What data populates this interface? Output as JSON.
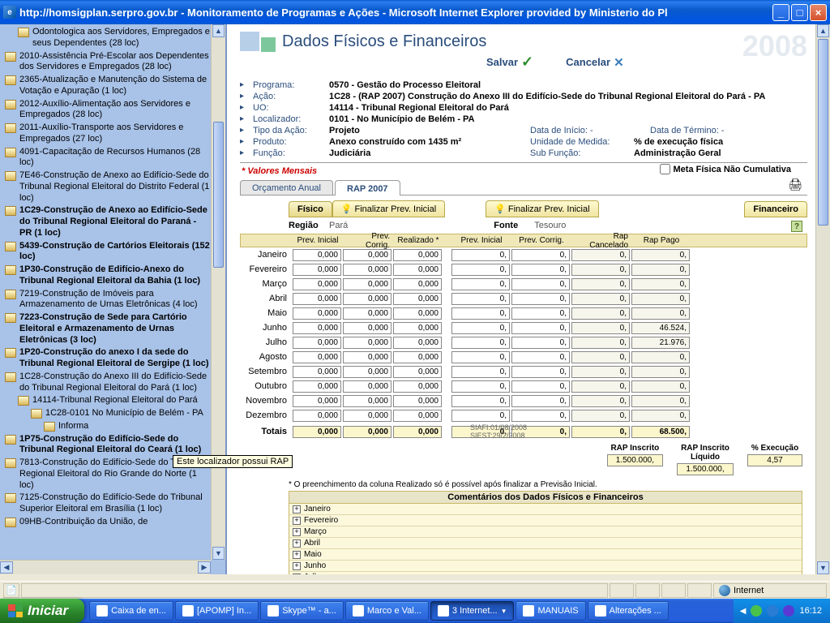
{
  "window": {
    "title": "http://homsigplan.serpro.gov.br - Monitoramento de Programas e Ações - Microsoft Internet Explorer provided by Ministerio do Pl"
  },
  "sidebar": {
    "items": [
      {
        "text": "Odontologica aos Servidores, Empregados e seus Dependentes (28 loc)",
        "bold": false,
        "indent": 1
      },
      {
        "text": "2010-Assistência Pré-Escolar aos Dependentes dos Servidores e Empregados (28 loc)",
        "bold": false,
        "indent": 0
      },
      {
        "text": "2365-Atualização e Manutenção do Sistema de Votação e Apuração (1 loc)",
        "bold": false,
        "indent": 0
      },
      {
        "text": "2012-Auxílio-Alimentação aos Servidores e Empregados (28 loc)",
        "bold": false,
        "indent": 0
      },
      {
        "text": "2011-Auxílio-Transporte aos Servidores e Empregados (27 loc)",
        "bold": false,
        "indent": 0
      },
      {
        "text": "4091-Capacitação de Recursos Humanos (28 loc)",
        "bold": false,
        "indent": 0
      },
      {
        "text": "7E46-Construção de Anexo ao Edifício-Sede do Tribunal Regional Eleitoral do Distrito Federal (1 loc)",
        "bold": false,
        "indent": 0
      },
      {
        "text": "1C29-Construção de Anexo ao Edifício-Sede do Tribunal Regional Eleitoral do Paraná - PR (1 loc)",
        "bold": true,
        "indent": 0
      },
      {
        "text": "5439-Construção de Cartórios Eleitorais (152 loc)",
        "bold": true,
        "indent": 0
      },
      {
        "text": "1P30-Construção de Edifício-Anexo do Tribunal Regional Eleitoral da Bahia (1 loc)",
        "bold": true,
        "indent": 0
      },
      {
        "text": "7219-Construção de Imóveis para Armazenamento de Urnas Eletrônicas (4 loc)",
        "bold": false,
        "indent": 0
      },
      {
        "text": "7223-Construção de Sede para Cartório Eleitoral e Armazenamento de Urnas Eletrônicas (3 loc)",
        "bold": true,
        "indent": 0
      },
      {
        "text": "1P20-Construção do anexo I da sede do Tribunal Regional Eleitoral de Sergipe (1 loc)",
        "bold": true,
        "indent": 0
      },
      {
        "text": "1C28-Construção do Anexo III do Edifício-Sede do Tribunal Regional Eleitoral do Pará (1 loc)",
        "bold": false,
        "indent": 0
      },
      {
        "text": "14114-Tribunal Regional Eleitoral do Pará",
        "bold": false,
        "indent": 1
      },
      {
        "text": "1C28-0101 No Município de Belém - PA",
        "bold": false,
        "indent": 2
      },
      {
        "text": "Informa",
        "bold": false,
        "indent": 3
      },
      {
        "text": "1P75-Construção do Edifício-Sede do Tribunal Regional Eleitoral do Ceará (1 loc)",
        "bold": true,
        "indent": 0
      },
      {
        "text": "7813-Construção do Edifício-Sede do Tribunal Regional Eleitoral do Rio Grande do Norte (1 loc)",
        "bold": false,
        "indent": 0
      },
      {
        "text": "7125-Construção do Edifício-Sede do Tribunal Superior Eleitoral em Brasília (1 loc)",
        "bold": false,
        "indent": 0
      },
      {
        "text": "09HB-Contribuição da União, de",
        "bold": false,
        "indent": 0
      }
    ],
    "tooltip": "Este localizador possui RAP"
  },
  "header": {
    "title": "Dados Físicos e Financeiros",
    "year": "2008",
    "salvar": "Salvar",
    "cancelar": "Cancelar"
  },
  "meta": {
    "programa_l": "Programa:",
    "programa": "0570 - Gestão do Processo Eleitoral",
    "acao_l": "Ação:",
    "acao": "1C28 - (RAP 2007) Construção do Anexo III do Edifício-Sede do Tribunal Regional Eleitoral do Pará - PA",
    "uo_l": "UO:",
    "uo": "14114 - Tribunal Regional Eleitoral do Pará",
    "loc_l": "Localizador:",
    "loc": "0101 - No Município de Belém - PA",
    "tipo_l": "Tipo da Ação:",
    "tipo": "Projeto",
    "di_l": "Data de Início: -",
    "dt_l": "Data de Término: -",
    "prod_l": "Produto:",
    "prod": "Anexo construído com 1435 m²",
    "um_l": "Unidade de Medida:",
    "um": "% de execução física",
    "func_l": "Função:",
    "func": "Judiciária",
    "sf_l": "Sub Função:",
    "sf": "Administração Geral",
    "valores": "* Valores Mensais",
    "meta_chk": "Meta Física Não Cumulativa"
  },
  "tabs": {
    "t1": "Orçamento Anual",
    "t2": "RAP 2007"
  },
  "subtabs": {
    "fisico": "Físico",
    "fp1": "Finalizar Prev. Inicial",
    "fp2": "Finalizar Prev. Inicial",
    "fin": "Financeiro"
  },
  "region": {
    "lbl": "Região",
    "val": "Pará",
    "fonte_l": "Fonte",
    "fonte_v": "Tesouro"
  },
  "grid": {
    "h1": "Prev. Inicial",
    "h2": "Prev. Corrig.",
    "h3": "Realizado *",
    "h4": "Prev. Inicial",
    "h5": "Prev. Corrig.",
    "h6": "Rap Cancelado",
    "h7": "Rap Pago",
    "months": [
      "Janeiro",
      "Fevereiro",
      "Março",
      "Abril",
      "Maio",
      "Junho",
      "Julho",
      "Agosto",
      "Setembro",
      "Outubro",
      "Novembro",
      "Dezembro"
    ],
    "phys": [
      [
        "0,000",
        "0,000",
        "0,000"
      ],
      [
        "0,000",
        "0,000",
        "0,000"
      ],
      [
        "0,000",
        "0,000",
        "0,000"
      ],
      [
        "0,000",
        "0,000",
        "0,000"
      ],
      [
        "0,000",
        "0,000",
        "0,000"
      ],
      [
        "0,000",
        "0,000",
        "0,000"
      ],
      [
        "0,000",
        "0,000",
        "0,000"
      ],
      [
        "0,000",
        "0,000",
        "0,000"
      ],
      [
        "0,000",
        "0,000",
        "0,000"
      ],
      [
        "0,000",
        "0,000",
        "0,000"
      ],
      [
        "0,000",
        "0,000",
        "0,000"
      ],
      [
        "0,000",
        "0,000",
        "0,000"
      ]
    ],
    "fin": [
      [
        "0,",
        "0,",
        "0,",
        "0,"
      ],
      [
        "0,",
        "0,",
        "0,",
        "0,"
      ],
      [
        "0,",
        "0,",
        "0,",
        "0,"
      ],
      [
        "0,",
        "0,",
        "0,",
        "0,"
      ],
      [
        "0,",
        "0,",
        "0,",
        "0,"
      ],
      [
        "0,",
        "0,",
        "0,",
        "46.524,"
      ],
      [
        "0,",
        "0,",
        "0,",
        "21.976,"
      ],
      [
        "0,",
        "0,",
        "0,",
        "0,"
      ],
      [
        "0,",
        "0,",
        "0,",
        "0,"
      ],
      [
        "0,",
        "0,",
        "0,",
        "0,"
      ],
      [
        "0,",
        "0,",
        "0,",
        "0,"
      ],
      [
        "0,",
        "0,",
        "0,",
        "0,"
      ]
    ],
    "total_l": "Totais",
    "total_phys": [
      "0,000",
      "0,000",
      "0,000"
    ],
    "total_fin": [
      "0,",
      "0,",
      "0,",
      "68.500,"
    ]
  },
  "rap": {
    "l1": "RAP Inscrito",
    "l2": "RAP Inscrito Líquido",
    "l3": "% Execução",
    "v1": "1.500.000,",
    "v2": "1.500.000,",
    "v3": "4,57"
  },
  "footnote": "* O preenchimento da coluna Realizado só é possível após finalizar a Previsão Inicial.",
  "comments": {
    "header": "Comentários dos Dados Físicos e Financeiros",
    "rows": [
      "Janeiro",
      "Fevereiro",
      "Março",
      "Abril",
      "Maio",
      "Junho",
      "Julho"
    ]
  },
  "siafi": {
    "a": "SIAFI:01/08/2008",
    "b": "SIEST:29/2/2008"
  },
  "status": {
    "zone": "Internet"
  },
  "taskbar": {
    "start": "Iniciar",
    "items": [
      {
        "label": "Caixa de en..."
      },
      {
        "label": "[APOMP] In..."
      },
      {
        "label": "Skype™ - a..."
      },
      {
        "label": "Marco e Val..."
      },
      {
        "label": "3 Internet...",
        "active": true
      },
      {
        "label": "MANUAIS"
      },
      {
        "label": "Alterações ..."
      }
    ],
    "clock": "16:12"
  }
}
